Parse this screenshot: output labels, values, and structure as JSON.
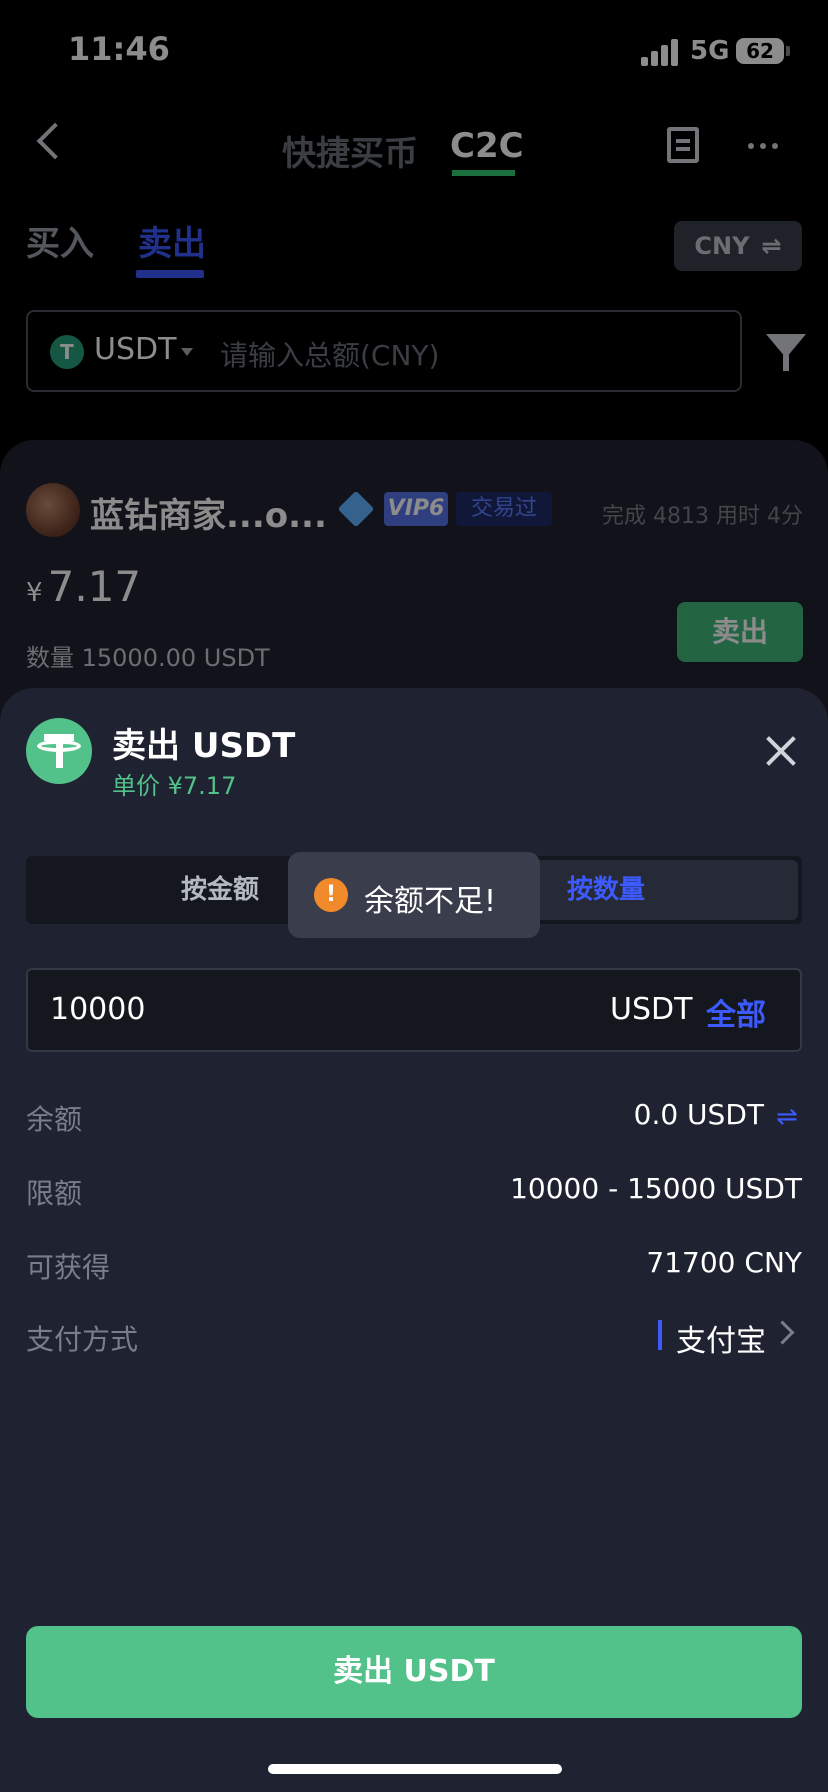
{
  "status_bar": {
    "time": "11:46",
    "network": "5G",
    "battery": "62"
  },
  "top_nav": {
    "tab_quick": "快捷买币",
    "tab_c2c": "C2C"
  },
  "trade_tabs": {
    "buy": "买入",
    "sell": "卖出"
  },
  "currency_toggle": {
    "label": "CNY",
    "icon": "⇌"
  },
  "filter": {
    "coin": "USDT",
    "placeholder": "请输入总额(CNY)"
  },
  "merchant": {
    "name": "蓝钻商家...o...",
    "vip": "VIP6",
    "traded_badge": "交易过",
    "stats": "完成 4813 用时 4分",
    "price_symbol": "¥",
    "price": "7.17",
    "quantity": "数量 15000.00 USDT",
    "sell_button": "卖出"
  },
  "sheet": {
    "title": "卖出 USDT",
    "unit_price": "单价 ¥7.17",
    "seg_by_amount": "按金额",
    "seg_by_quantity": "按数量",
    "toast": "余额不足!",
    "input_value": "10000",
    "input_unit": "USDT",
    "input_all": "全部",
    "rows": {
      "balance_label": "余额",
      "balance_value": "0.0 USDT",
      "limit_label": "限额",
      "limit_value": "10000 - 15000 USDT",
      "receive_label": "可获得",
      "receive_value": "71700 CNY",
      "payment_label": "支付方式",
      "payment_value": "支付宝"
    },
    "submit": "卖出 USDT"
  },
  "colors": {
    "accent_blue": "#3d5afe",
    "green": "#52c28a",
    "toast_warning": "#f08a2a",
    "sheet_bg": "#1f2230"
  }
}
